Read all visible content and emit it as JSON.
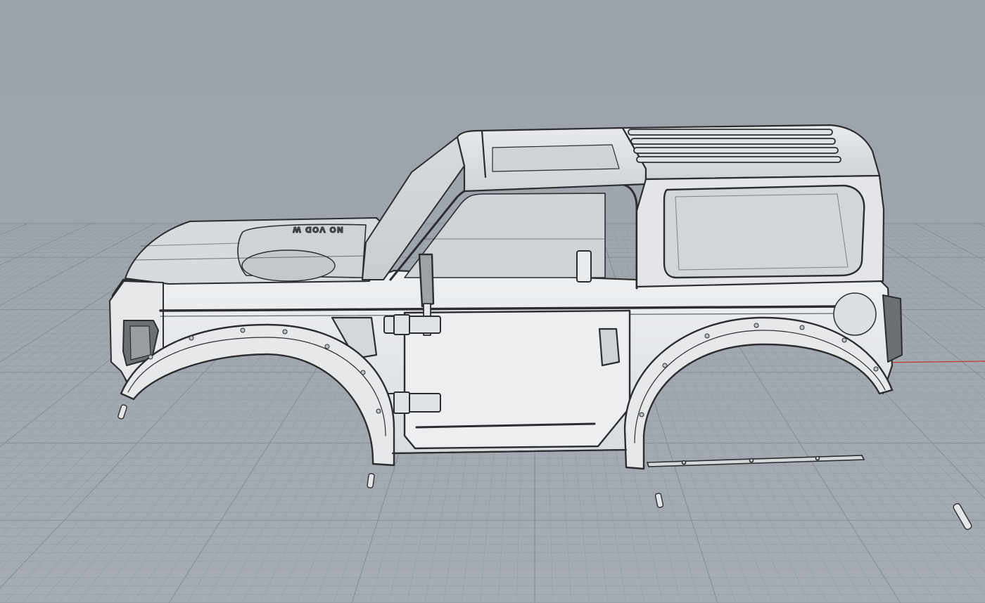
{
  "viewport": {
    "name": "perspective-viewport",
    "colors": {
      "background": "#9ea4ac",
      "grid_minor": "#959ba3",
      "grid_major": "#868c94",
      "x_axis": "#c0392b",
      "model_stroke": "#2b2d30",
      "model_fill": "#e4e6e8"
    }
  },
  "model": {
    "hood_emboss_text": "NO VOD W"
  }
}
